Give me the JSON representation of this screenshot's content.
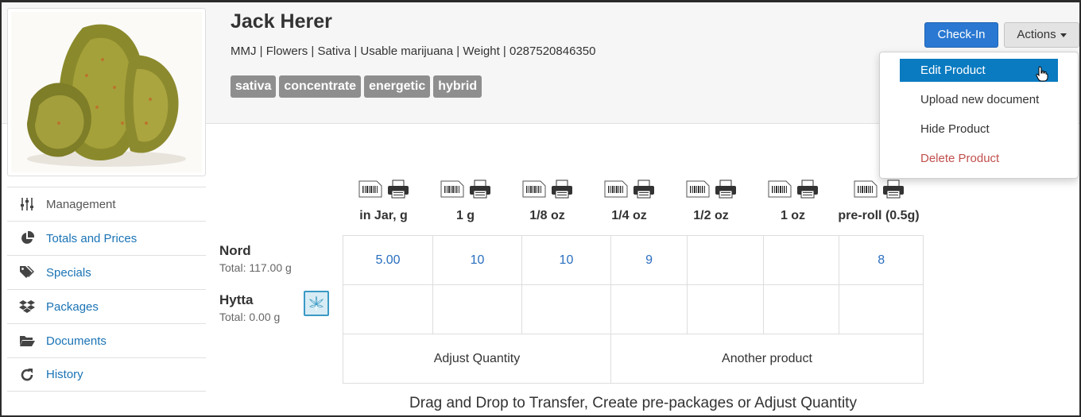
{
  "product": {
    "title": "Jack Herer",
    "subtitle": "MMJ | Flowers | Sativa | Usable marijuana | Weight | 0287520846350",
    "tags": [
      "sativa",
      "concentrate",
      "energetic",
      "hybrid"
    ]
  },
  "buttons": {
    "checkin": "Check-In",
    "actions": "Actions"
  },
  "actions_menu": [
    {
      "label": "Edit Product"
    },
    {
      "label": "Upload new document"
    },
    {
      "label": "Hide Product"
    },
    {
      "label": "Delete Product"
    }
  ],
  "sidebar": [
    {
      "label": "Management",
      "icon": "sliders-icon"
    },
    {
      "label": "Totals and Prices",
      "icon": "pie-chart-icon"
    },
    {
      "label": "Specials",
      "icon": "tags-icon"
    },
    {
      "label": "Packages",
      "icon": "dropbox-icon"
    },
    {
      "label": "Documents",
      "icon": "folder-open-icon"
    },
    {
      "label": "History",
      "icon": "refresh-icon"
    }
  ],
  "columns": [
    "in Jar, g",
    "1 g",
    "1/8 oz",
    "1/4 oz",
    "1/2 oz",
    "1 oz",
    "pre-roll (0.5g)"
  ],
  "locations": [
    {
      "name": "Nord",
      "total": "Total: 117.00 g",
      "values": [
        "5.00",
        "10",
        "10",
        "9",
        "",
        "",
        "8"
      ]
    },
    {
      "name": "Hytta",
      "total": "Total: 0.00 g",
      "values": [
        "",
        "",
        "",
        "",
        "",
        "",
        ""
      ]
    }
  ],
  "drop_zones": [
    "Adjust Quantity",
    "Another product"
  ],
  "footer": "Drag and Drop to Transfer, Create pre-packages or Adjust Quantity",
  "colors": {
    "accent": "#2a78d2",
    "menu_active": "#0b7bc1",
    "danger": "#c0504d",
    "tag": "#8e8e8e",
    "link": "#1a73b5"
  }
}
